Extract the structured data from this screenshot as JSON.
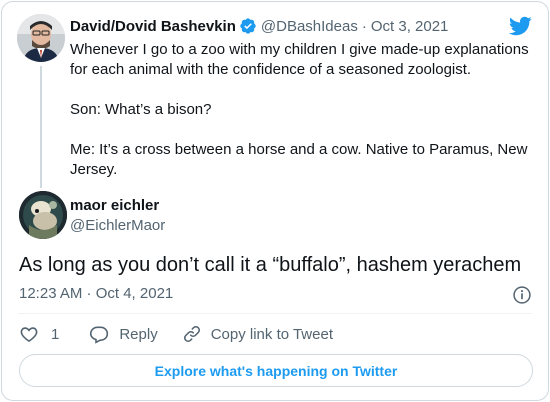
{
  "parent_tweet": {
    "author_name": "David/Dovid Bashevkin",
    "handle": "@DBashIdeas",
    "separator": "·",
    "date": "Oct 3, 2021",
    "paragraphs": [
      "Whenever I go to a zoo with my children I give made-up explanations for each animal with the confidence of a seasoned zoologist.",
      "Son: What’s a bison?",
      "Me: It’s a cross between a horse and a cow. Native to Paramus, New Jersey."
    ]
  },
  "reply_tweet": {
    "author_name": "maor eichler",
    "handle": "@EichlerMaor",
    "text": "As long as you don’t call it a “buffalo”, hashem yerachem",
    "timestamp": "12:23 AM · Oct 4, 2021"
  },
  "actions": {
    "like_count": "1",
    "reply_label": "Reply",
    "copy_label": "Copy link to Tweet"
  },
  "explore_label": "Explore what's happening on Twitter",
  "colors": {
    "accent": "#1d9bf0",
    "text_primary": "#0f1419",
    "text_secondary": "#536471",
    "border": "#cfd9de"
  },
  "icons": [
    "verified-badge-icon",
    "twitter-bird-icon",
    "info-icon",
    "heart-icon",
    "reply-bubble-icon",
    "link-icon"
  ]
}
